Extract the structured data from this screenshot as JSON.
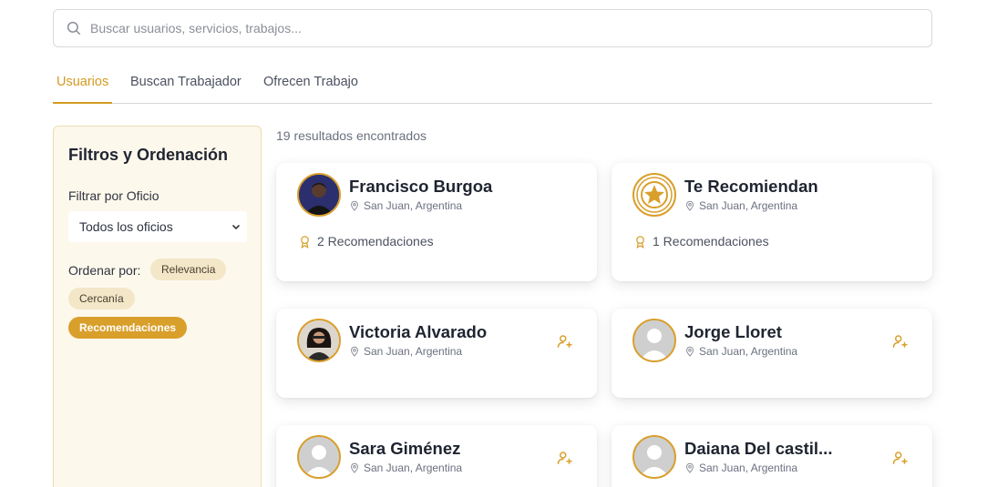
{
  "search": {
    "placeholder": "Buscar usuarios, servicios, trabajos..."
  },
  "tabs": [
    {
      "label": "Usuarios"
    },
    {
      "label": "Buscan Trabajador"
    },
    {
      "label": "Ofrecen Trabajo"
    }
  ],
  "filters": {
    "title": "Filtros y Ordenación",
    "trade_label": "Filtrar por Oficio",
    "trade_selected": "Todos los oficios",
    "order_label": "Ordenar por:",
    "order_options": [
      "Relevancia",
      "Cercanía",
      "Recomendaciones"
    ],
    "order_active": "Recomendaciones"
  },
  "results_text": "19 resultados encontrados",
  "cards": [
    {
      "name": "Francisco Burgoa",
      "location": "San Juan, Argentina",
      "recommendations": "2 Recomendaciones",
      "avatar": "photo-man"
    },
    {
      "name": "Te Recomiendan",
      "location": "San Juan, Argentina",
      "recommendations": "1 Recomendaciones",
      "avatar": "star-badge"
    },
    {
      "name": "Victoria Alvarado",
      "location": "San Juan, Argentina",
      "avatar": "photo-woman"
    },
    {
      "name": "Jorge Lloret",
      "location": "San Juan, Argentina",
      "avatar": "default-user"
    },
    {
      "name": "Sara Giménez",
      "location": "San Juan, Argentina",
      "avatar": "default-user"
    },
    {
      "name": "Daiana Del castil...",
      "location": "San Juan, Argentina",
      "avatar": "default-user"
    }
  ],
  "colors": {
    "accent": "#d99f2b",
    "tab_active": "#d49a1f",
    "filter_bg": "#fdf8ec"
  }
}
